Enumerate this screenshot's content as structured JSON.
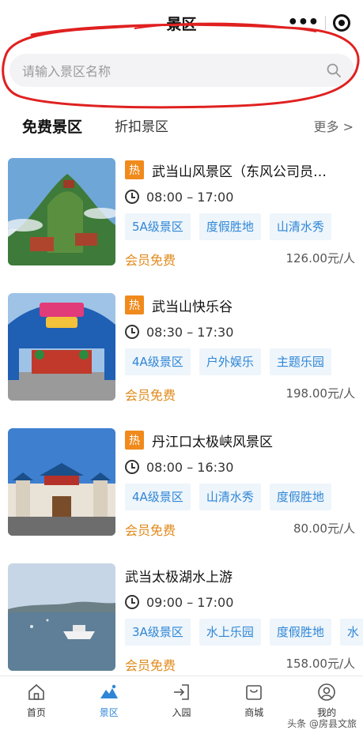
{
  "header": {
    "title": "景区"
  },
  "search": {
    "placeholder": "请输入景区名称"
  },
  "tabs": {
    "free": "免费景区",
    "discount": "折扣景区",
    "more": "更多 >"
  },
  "items": [
    {
      "hot": "热",
      "title": "武当山风景区（东风公司员…",
      "time": "08:00 – 17:00",
      "tags": [
        "5A级景区",
        "度假胜地",
        "山清水秀"
      ],
      "member": "会员免费",
      "price": "126.00元/人"
    },
    {
      "hot": "热",
      "title": "武当山快乐谷",
      "time": "08:30 – 17:30",
      "tags": [
        "4A级景区",
        "户外娱乐",
        "主题乐园"
      ],
      "member": "会员免费",
      "price": "198.00元/人"
    },
    {
      "hot": "热",
      "title": "丹江口太极峡风景区",
      "time": "08:00 – 16:30",
      "tags": [
        "4A级景区",
        "山清水秀",
        "度假胜地"
      ],
      "member": "会员免费",
      "price": "80.00元/人"
    },
    {
      "title": "武当太极湖水上游",
      "time": "09:00 – 17:00",
      "tags": [
        "3A级景区",
        "水上乐园",
        "度假胜地",
        "水"
      ],
      "member": "会员免费",
      "price": "158.00元/人"
    }
  ],
  "nav": [
    {
      "label": "首页",
      "icon": "home-icon"
    },
    {
      "label": "景区",
      "icon": "mountain-icon"
    },
    {
      "label": "入园",
      "icon": "enter-icon"
    },
    {
      "label": "商城",
      "icon": "shop-icon"
    },
    {
      "label": "我的",
      "icon": "user-icon"
    }
  ],
  "watermark": "头条 @房县文旅",
  "colors": {
    "accent": "#2f86d6",
    "hot": "#f08a1c",
    "member": "#e08a1b",
    "annotation": "#e02020"
  }
}
